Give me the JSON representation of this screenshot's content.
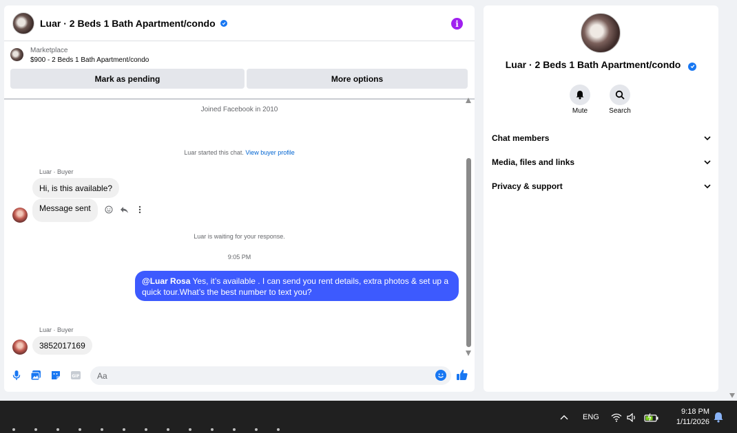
{
  "chat": {
    "title": "Luar · 2 Beds 1 Bath Apartment/condo",
    "info_label": "i",
    "marketplace": {
      "label": "Marketplace",
      "item": "$900 - 2 Beds 1 Bath Apartment/condo",
      "mark_pending": "Mark as pending",
      "more_options": "More options"
    },
    "thread": {
      "joined": "Joined Facebook in 2010",
      "started_text": "Luar started this chat.",
      "view_profile": "View buyer profile",
      "sender_label_1": "Luar · Buyer",
      "msg_1": "Hi, is this available?",
      "msg_2": "Message sent",
      "waiting": "Luar is waiting for your response.",
      "time": "9:05 PM",
      "out_mention": "@Luar Rosa",
      "out_text": " Yes, it’s available .  I can send you rent details, extra photos & set up a quick tour.What’s the best number to text you?",
      "sender_label_2": "Luar · Buyer",
      "msg_3": "3852017169"
    },
    "composer": {
      "placeholder": "Aa"
    }
  },
  "side": {
    "title": "Luar · 2 Beds 1 Bath Apartment/condo",
    "mute": "Mute",
    "search": "Search",
    "sections": [
      "Chat members",
      "Media, files and links",
      "Privacy & support"
    ]
  },
  "taskbar": {
    "language": "ENG",
    "time": "9:18 PM",
    "date": "1/11/2026"
  },
  "colors": {
    "accent": "#1877f2",
    "outgoing_bubble": "#3d5afe",
    "info_purple": "#a020f0"
  }
}
